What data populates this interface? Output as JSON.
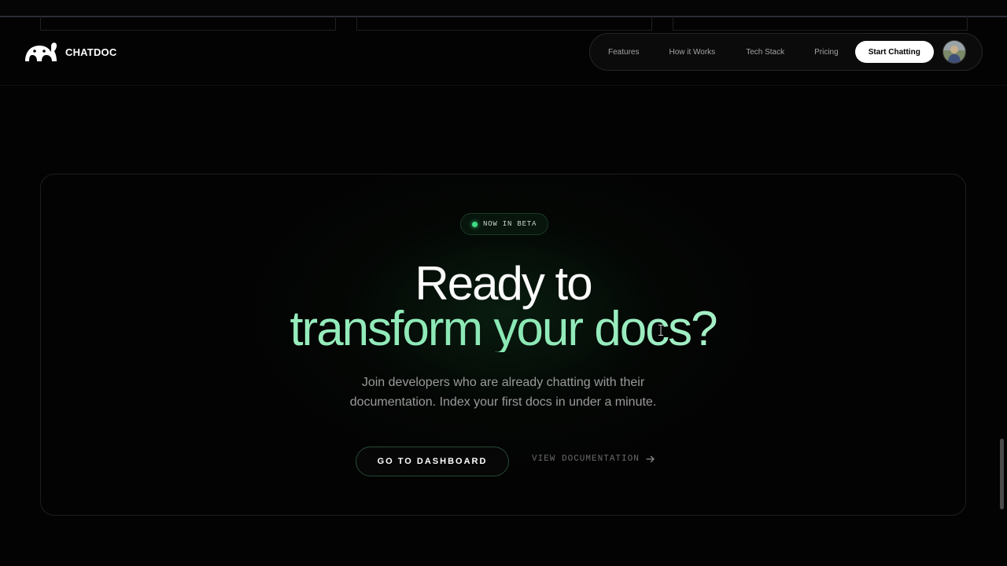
{
  "brand": {
    "name": "CHATDOC",
    "logo_icon": "chatdoc-logo-icon"
  },
  "nav": {
    "links": [
      "Features",
      "How it Works",
      "Tech Stack",
      "Pricing"
    ],
    "cta": "Start Chatting",
    "avatar_icon": "user-avatar"
  },
  "hero": {
    "badge": "NOW IN BETA",
    "title_line1": "Ready to",
    "title_line2": "transform your docs?",
    "subtitle_line1": "Join developers who are already chatting with their",
    "subtitle_line2": "documentation. Index your first docs in under a minute.",
    "primary_button": "GO TO DASHBOARD",
    "secondary_link": "VIEW DOCUMENTATION",
    "secondary_icon": "arrow-right-icon"
  },
  "colors": {
    "background": "#030303",
    "accent_green": "#3ddc84",
    "heading_gradient": "#a6f0c6",
    "cta_bg": "#ffffff"
  }
}
